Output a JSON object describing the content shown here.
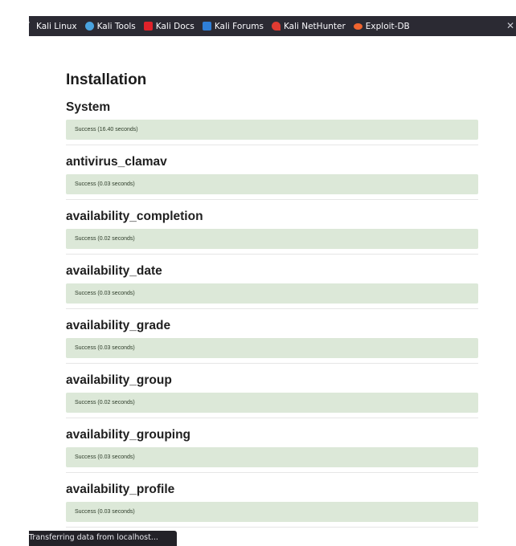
{
  "bookmarks": [
    {
      "label": "Kali Linux",
      "icon": "kali-dragon-icon"
    },
    {
      "label": "Kali Tools",
      "icon": "kali-tools-icon"
    },
    {
      "label": "Kali Docs",
      "icon": "kali-docs-icon"
    },
    {
      "label": "Kali Forums",
      "icon": "kali-forums-icon"
    },
    {
      "label": "Kali NetHunter",
      "icon": "kali-nethunter-icon"
    },
    {
      "label": "Exploit-DB",
      "icon": "exploit-db-icon"
    }
  ],
  "close_glyph": "✕",
  "page": {
    "title": "Installation",
    "sections": [
      {
        "title": "System",
        "status": "Success (16.40 seconds)"
      },
      {
        "title": "antivirus_clamav",
        "status": "Success (0.03 seconds)"
      },
      {
        "title": "availability_completion",
        "status": "Success (0.02 seconds)"
      },
      {
        "title": "availability_date",
        "status": "Success (0.03 seconds)"
      },
      {
        "title": "availability_grade",
        "status": "Success (0.03 seconds)"
      },
      {
        "title": "availability_group",
        "status": "Success (0.02 seconds)"
      },
      {
        "title": "availability_grouping",
        "status": "Success (0.03 seconds)"
      },
      {
        "title": "availability_profile",
        "status": "Success (0.03 seconds)"
      }
    ]
  },
  "statusbar": {
    "text": "Transferring data from localhost..."
  },
  "colors": {
    "bookmark_bar": "#2b2a33",
    "success_bg": "#dce8d8",
    "statusbar": "#232228"
  }
}
